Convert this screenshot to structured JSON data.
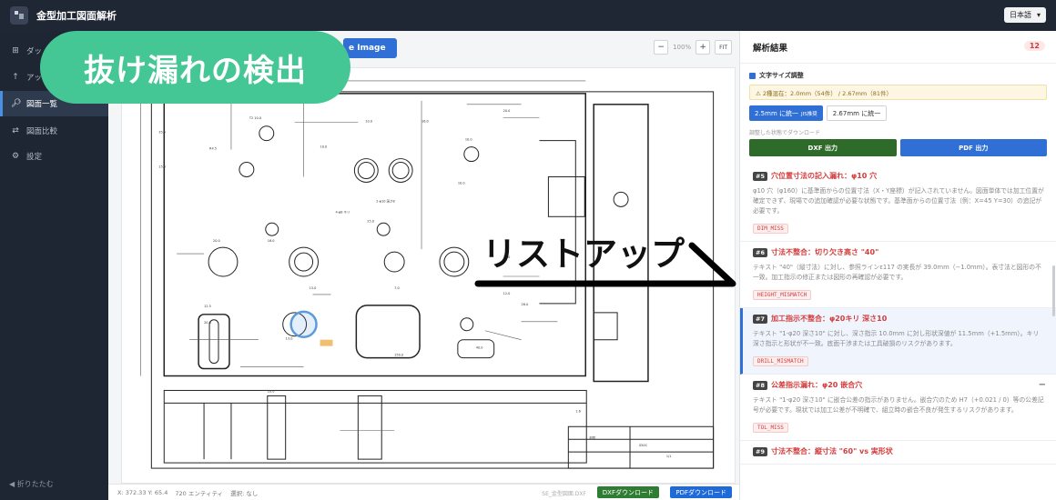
{
  "header": {
    "app_title": "金型加工図面解析",
    "language": "日本語"
  },
  "sidebar": {
    "items": [
      {
        "label": "ダッ",
        "icon": "grid-icon"
      },
      {
        "label": "アッ",
        "icon": "upload-arrow-icon"
      },
      {
        "label": "図面一覧",
        "icon": "search-icon"
      },
      {
        "label": "図面比較",
        "icon": "swap-icon"
      },
      {
        "label": "設定",
        "icon": "gear-icon"
      }
    ],
    "collapse_label": "◀ 折りたたむ"
  },
  "toolbar": {
    "upload_label": "e Image",
    "zoom_minus": "−",
    "zoom_level": "100%",
    "zoom_plus": "+",
    "zoom_fit": "FIT"
  },
  "statusbar": {
    "coords": "X: 372.33  Y: 65.4",
    "entities": "720 エンティティ",
    "selection": "選択: なし",
    "file": "SE_金型図面.DXF",
    "dxf_download": "DXFダウンロード",
    "pdf_download": "PDFダウンロード"
  },
  "panel": {
    "title": "解析結果",
    "count": "12",
    "font_section": {
      "title": "文字サイズ調整",
      "warning": "⚠ 2種混在：2.0mm（54件） / 2.67mm（81件）",
      "unify_primary": "2.5mm に統一",
      "unify_primary_note": "JIS推奨",
      "unify_secondary": "2.67mm に統一",
      "adjust_label": "調整した状態でダウンロード",
      "dxf_output": "DXF 出力",
      "pdf_output": "PDF 出力"
    },
    "issues": [
      {
        "num": "#5",
        "title": "穴位置寸法の記入漏れ：φ10 穴",
        "body": "φ10 穴（φ160）に基準面からの位置寸法（X・Y座標）が記入されていません。図面単体では加工位置が確定できず、現場での追加確認が必要な状態です。基準面からの位置寸法（例：X=45 Y=30）の追記が必要です。",
        "code": "DIM_MISS"
      },
      {
        "num": "#6",
        "title": "寸法不整合：切り欠き高さ \"40\"",
        "body": "テキスト \"40\"（縦寸法）に対し、参照ラインε117 の実長が 39.0mm（−1.0mm）。表寸法と図形の不一致。加工指示の修正または図形の再確認が必要です。",
        "code": "HEIGHT_MISMATCH"
      },
      {
        "num": "#7",
        "title": "加工指示不整合：φ20キリ 深さ10",
        "body": "テキスト \"1-φ20 深さ10\" に対し、深さ指示 10.0mm に対し形状深値が 11.5mm（+1.5mm）。キリ深さ指示と形状が不一致。底面干渉または工具破損のリスクがあります。",
        "code": "DRILL_MISMATCH"
      },
      {
        "num": "#8",
        "title": "公差指示漏れ：φ20 嵌合穴",
        "body": "テキスト \"1-φ20 深さ10\" に嵌合公差の指示がありません。嵌合穴のため H7（+0.021 / 0）等の公差記号が必要です。現状では加工公差が不明確で、組立時の嵌合不良が発生するリスクがあります。",
        "code": "TOL_MISS"
      },
      {
        "num": "#9",
        "title": "寸法不整合：縦寸法 \"60\" vs 実形状",
        "body": "",
        "code": ""
      }
    ]
  },
  "overlays": {
    "missing_detection": "抜け漏れの検出",
    "list_up": "リストアップ"
  },
  "colors": {
    "sidebar_bg": "#1e2634",
    "accent_blue": "#2f6fd6",
    "error_red": "#d23c3c",
    "overlay_green": "#45c795"
  }
}
